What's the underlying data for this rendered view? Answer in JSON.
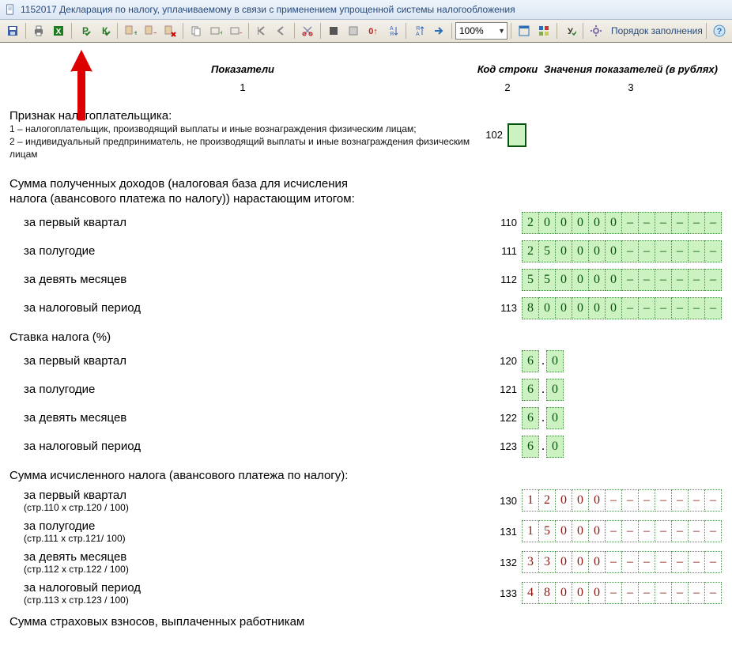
{
  "window": {
    "title": "1152017 Декларация по налогу, уплачиваемому в связи с применением упрощенной системы налогообложения"
  },
  "toolbar": {
    "zoom": "100%",
    "fill_order": "Порядок заполнения"
  },
  "headers": {
    "col1": "Показатели",
    "col2": "Код строки",
    "col3": "Значения показателей (в рублях)"
  },
  "index": {
    "c1": "1",
    "c2": "2",
    "c3": "3"
  },
  "taxpayer_sign": {
    "title": "Признак налогоплательщика:",
    "note1": "1 – налогоплательщик, производящий выплаты и иные вознаграждения физическим лицам;",
    "note2": "2 – индивидуальный предприниматель, не производящий выплаты и иные вознаграждения физическим лицам",
    "code": "102"
  },
  "income": {
    "title1": "Сумма полученных доходов (налоговая база для исчисления",
    "title2": "налога (авансового платежа по налогу)) нарастающим итогом:",
    "rows": [
      {
        "label": "за первый квартал",
        "code": "110",
        "digits": [
          "2",
          "0",
          "0",
          "0",
          "0",
          "0",
          "–",
          "–",
          "–",
          "–",
          "–",
          "–"
        ]
      },
      {
        "label": "за полугодие",
        "code": "111",
        "digits": [
          "2",
          "5",
          "0",
          "0",
          "0",
          "0",
          "–",
          "–",
          "–",
          "–",
          "–",
          "–"
        ]
      },
      {
        "label": "за девять месяцев",
        "code": "112",
        "digits": [
          "5",
          "5",
          "0",
          "0",
          "0",
          "0",
          "–",
          "–",
          "–",
          "–",
          "–",
          "–"
        ]
      },
      {
        "label": "за налоговый период",
        "code": "113",
        "digits": [
          "8",
          "0",
          "0",
          "0",
          "0",
          "0",
          "–",
          "–",
          "–",
          "–",
          "–",
          "–"
        ]
      }
    ]
  },
  "rate": {
    "title": "Ставка налога (%)",
    "rows": [
      {
        "label": "за первый квартал",
        "code": "120",
        "a": "6",
        "b": "0"
      },
      {
        "label": "за полугодие",
        "code": "121",
        "a": "6",
        "b": "0"
      },
      {
        "label": "за девять месяцев",
        "code": "122",
        "a": "6",
        "b": "0"
      },
      {
        "label": "за налоговый период",
        "code": "123",
        "a": "6",
        "b": "0"
      }
    ]
  },
  "calc": {
    "title": "Сумма исчисленного налога (авансового платежа по налогу):",
    "rows": [
      {
        "label": "за первый квартал",
        "sub": "(стр.110 х стр.120 / 100)",
        "code": "130",
        "digits": [
          "1",
          "2",
          "0",
          "0",
          "0",
          "–",
          "–",
          "–",
          "–",
          "–",
          "–",
          "–"
        ]
      },
      {
        "label": "за полугодие",
        "sub": "(стр.111 х стр.121/ 100)",
        "code": "131",
        "digits": [
          "1",
          "5",
          "0",
          "0",
          "0",
          "–",
          "–",
          "–",
          "–",
          "–",
          "–",
          "–"
        ]
      },
      {
        "label": "за девять месяцев",
        "sub": "(стр.112 х стр.122 / 100)",
        "code": "132",
        "digits": [
          "3",
          "3",
          "0",
          "0",
          "0",
          "–",
          "–",
          "–",
          "–",
          "–",
          "–",
          "–"
        ]
      },
      {
        "label": "за налоговый период",
        "sub": "(стр.113 х стр.123 / 100)",
        "code": "133",
        "digits": [
          "4",
          "8",
          "0",
          "0",
          "0",
          "–",
          "–",
          "–",
          "–",
          "–",
          "–",
          "–"
        ]
      }
    ]
  },
  "footer": {
    "text": "Сумма страховых взносов, выплаченных работникам"
  }
}
